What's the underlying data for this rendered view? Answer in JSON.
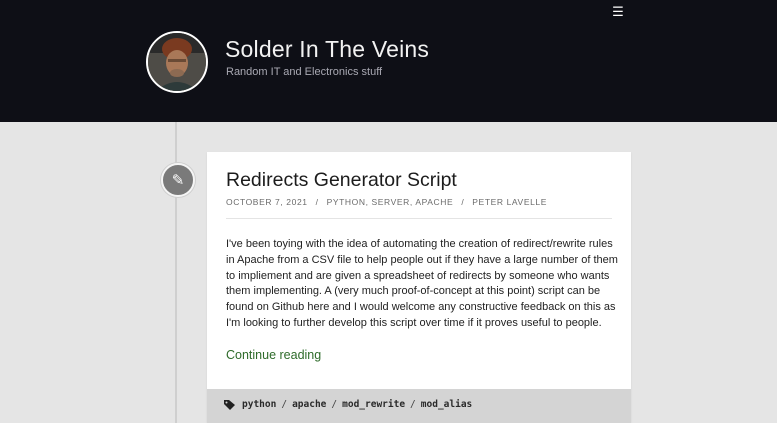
{
  "header": {
    "menu_icon": "hamburger-menu-icon",
    "site_title": "Solder In The Veins",
    "tagline": "Random IT and Electronics stuff"
  },
  "post": {
    "icon": "pencil-icon",
    "title": "Redirects Generator Script",
    "date": "OCTOBER 7, 2021",
    "categories": "PYTHON, SERVER, APACHE",
    "author": "PETER LAVELLE",
    "excerpt": "I've been toying with the idea of automating the creation of redirect/rewrite rules in Apache from a CSV file to help people out if they have a large number of them to impliement and are given a spreadsheet of redirects by someone who wants them implementing. A (very much proof-of-concept at this point) script can be found on Github here and I would welcome any constructive feedback on this as I'm looking to further develop this script over time if it proves useful to people.",
    "continue_label": "Continue reading",
    "tags_icon": "tags-icon",
    "tags": [
      "python",
      "apache",
      "mod_rewrite",
      "mod_alias"
    ],
    "tag_separator": "/"
  },
  "colors": {
    "header_bg": "#0e0f16",
    "page_bg": "#e5e5e5",
    "link_green": "#2e6b2a",
    "footer_bg": "#d4d4d4"
  }
}
